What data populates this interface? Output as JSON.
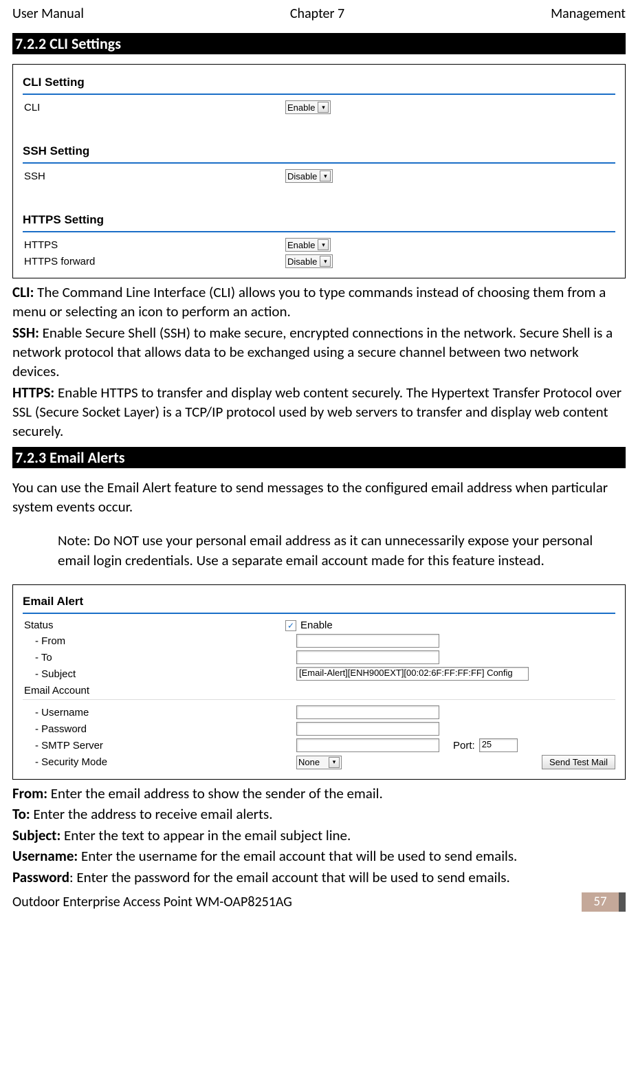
{
  "header": {
    "left": "User Manual",
    "center": "Chapter 7",
    "right": "Management"
  },
  "sections": {
    "cli_title": "7.2.2 CLI Settings",
    "email_title": "7.2.3 Email Alerts"
  },
  "cli_box": {
    "group1": "CLI Setting",
    "row1_label": "CLI",
    "row1_value": "Enable",
    "group2": "SSH Setting",
    "row2_label": "SSH",
    "row2_value": "Disable",
    "group3": "HTTPS Setting",
    "row3_label": "HTTPS",
    "row3_value": "Enable",
    "row4_label": "HTTPS forward",
    "row4_value": "Disable"
  },
  "cli_desc": {
    "cli_label": "CLI:",
    "cli_text": " The Command Line Interface (CLI) allows you to type commands instead of choosing them from a menu or selecting an icon to perform an action.",
    "ssh_label": "SSH:",
    "ssh_text": " Enable Secure Shell (SSH) to make secure, encrypted connections in the network. Secure Shell is a network protocol that allows data to be exchanged using a secure channel between two network devices.",
    "https_label": "HTTPS:",
    "https_text": " Enable HTTPS to transfer and display web content securely. The Hypertext Transfer Protocol over SSL (Secure Socket Layer) is a TCP/IP protocol used by web servers to transfer and display web content securely."
  },
  "email_desc": {
    "intro": "You can use the Email Alert feature to send messages to the configured email address when particular system events occur.",
    "note_label": "Note:",
    "note_text_pre": " Do ",
    "note_bold": "NOT",
    "note_text_post": " use your personal email address as it can unnecessarily expose your personal email login credentials. Use a separate email account made for this feature instead."
  },
  "email_box": {
    "group": "Email Alert",
    "status_label": "Status",
    "enable_label": "Enable",
    "from_label": "- From",
    "to_label": "- To",
    "subject_label": "- Subject",
    "subject_value": "[Email-Alert][ENH900EXT][00:02:6F:FF:FF:FF] Config",
    "account_group": "Email Account",
    "user_label": "- Username",
    "pass_label": "- Password",
    "smtp_label": "- SMTP Server",
    "port_label": "Port:",
    "port_value": "25",
    "security_label": "- Security Mode",
    "security_value": "None",
    "button": "Send Test Mail"
  },
  "field_desc": {
    "from_label": "From:",
    "from_text": " Enter the email address to show the sender of the email.",
    "to_label": "To:",
    "to_text": " Enter the address to receive email alerts.",
    "subject_label": "Subject:",
    "subject_text": " Enter the text to appear in the email subject line.",
    "user_label": "Username:",
    "user_text": " Enter the username for the email account that will be used to send emails.",
    "pass_label": "Password",
    "pass_text": ": Enter the password for the email account that will be used to send emails."
  },
  "footer": {
    "text": "Outdoor Enterprise Access Point WM-OAP8251AG",
    "page": "57"
  }
}
